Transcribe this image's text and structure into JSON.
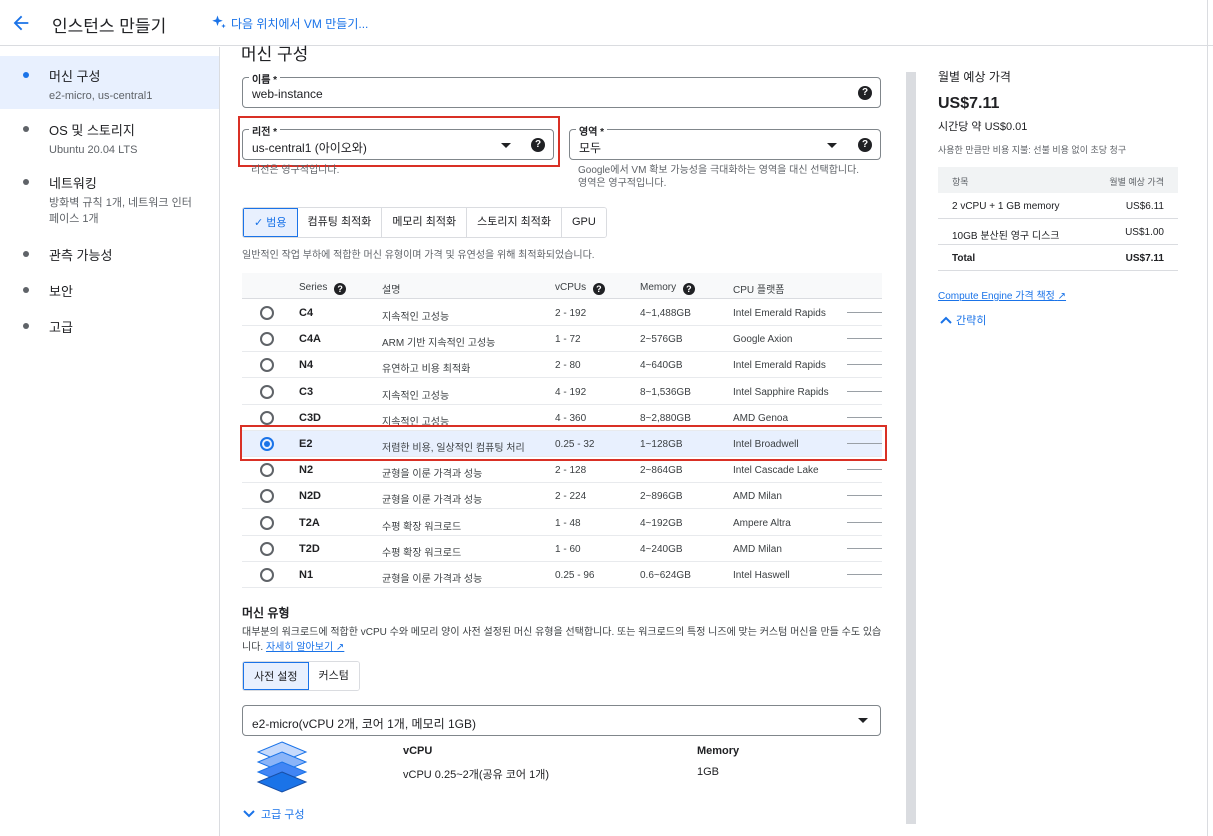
{
  "header": {
    "title": "인스턴스 만들기",
    "vm_link": "다음 위치에서 VM 만들기..."
  },
  "sidebar": {
    "items": [
      {
        "label": "머신 구성",
        "sub": "e2-micro, us-central1"
      },
      {
        "label": "OS 및 스토리지",
        "sub": "Ubuntu 20.04 LTS"
      },
      {
        "label": "네트워킹",
        "sub": "방화벽 규칙 1개, 네트워크 인터페이스 1개"
      },
      {
        "label": "관측 가능성",
        "sub": ""
      },
      {
        "label": "보안",
        "sub": ""
      },
      {
        "label": "고급",
        "sub": ""
      }
    ]
  },
  "main": {
    "section_title": "머신 구성",
    "name_field": {
      "label": "이름 *",
      "value": "web-instance"
    },
    "region_field": {
      "label": "리전 *",
      "value": "us-central1 (아이오와)",
      "hint": "리전은 영구적입니다."
    },
    "zone_field": {
      "label": "영역 *",
      "value": "모두",
      "hint": "Google에서 VM 확보 가능성을 극대화하는 영역을 대신 선택합니다. 영역은 영구적입니다."
    },
    "family_tabs": [
      "범용",
      "컴퓨팅 최적화",
      "메모리 최적화",
      "스토리지 최적화",
      "GPU"
    ],
    "family_desc": "일반적인 작업 부하에 적합한 머신 유형이며 가격 및 유연성을 위해 최적화되었습니다.",
    "table": {
      "headers": [
        "Series",
        "설명",
        "vCPUs",
        "Memory",
        "CPU 플랫폼"
      ],
      "rows": [
        {
          "series": "C4",
          "desc": "지속적인 고성능",
          "vcpus": "2 - 192",
          "memory": "4~1,488GB",
          "platform": "Intel Emerald Rapids",
          "selected": false
        },
        {
          "series": "C4A",
          "desc": "ARM 기반 지속적인 고성능",
          "vcpus": "1 - 72",
          "memory": "2~576GB",
          "platform": "Google Axion",
          "selected": false
        },
        {
          "series": "N4",
          "desc": "유연하고 비용 최적화",
          "vcpus": "2 - 80",
          "memory": "4~640GB",
          "platform": "Intel Emerald Rapids",
          "selected": false
        },
        {
          "series": "C3",
          "desc": "지속적인 고성능",
          "vcpus": "4 - 192",
          "memory": "8~1,536GB",
          "platform": "Intel Sapphire Rapids",
          "selected": false
        },
        {
          "series": "C3D",
          "desc": "지속적인 고성능",
          "vcpus": "4 - 360",
          "memory": "8~2,880GB",
          "platform": "AMD Genoa",
          "selected": false
        },
        {
          "series": "E2",
          "desc": "저렴한 비용, 일상적인 컴퓨팅 처리",
          "vcpus": "0.25 - 32",
          "memory": "1~128GB",
          "platform": "Intel Broadwell",
          "selected": true
        },
        {
          "series": "N2",
          "desc": "균형을 이룬 가격과 성능",
          "vcpus": "2 - 128",
          "memory": "2~864GB",
          "platform": "Intel Cascade Lake",
          "selected": false
        },
        {
          "series": "N2D",
          "desc": "균형을 이룬 가격과 성능",
          "vcpus": "2 - 224",
          "memory": "2~896GB",
          "platform": "AMD Milan",
          "selected": false
        },
        {
          "series": "T2A",
          "desc": "수평 확장 워크로드",
          "vcpus": "1 - 48",
          "memory": "4~192GB",
          "platform": "Ampere Altra",
          "selected": false
        },
        {
          "series": "T2D",
          "desc": "수평 확장 워크로드",
          "vcpus": "1 - 60",
          "memory": "4~240GB",
          "platform": "AMD Milan",
          "selected": false
        },
        {
          "series": "N1",
          "desc": "균형을 이룬 가격과 성능",
          "vcpus": "0.25 - 96",
          "memory": "0.6~624GB",
          "platform": "Intel Haswell",
          "selected": false
        }
      ]
    },
    "machine_type": {
      "title": "머신 유형",
      "desc": "대부분의 워크로드에 적합한 vCPU 수와 메모리 양이 사전 설정된 머신 유형을 선택합니다. 또는 워크로드의 특정 니즈에 맞는 커스텀 머신을 만들 수도 있습니다.",
      "learn_more": "자세히 알아보기",
      "tabs": [
        "사전 설정",
        "커스텀"
      ],
      "selected_type": "e2-micro(vCPU 2개, 코어 1개, 메모리 1GB)",
      "vcpu_head": "vCPU",
      "vcpu_val": "vCPU 0.25~2개(공유 코어 1개)",
      "mem_head": "Memory",
      "mem_val": "1GB",
      "advanced": "고급 구성"
    }
  },
  "pricing": {
    "title": "월별 예상 가격",
    "price": "US$7.11",
    "hourly": "시간당 약 US$0.01",
    "note": "사용한 만큼만 비용 지불: 선불 비용 없이 초당 청구",
    "table_head": [
      "항목",
      "월별 예상 가격"
    ],
    "rows": [
      {
        "item": "2 vCPU + 1 GB memory",
        "price": "US$6.11"
      },
      {
        "item": "10GB 분산된 영구 디스크",
        "price": "US$1.00"
      },
      {
        "item": "Total",
        "price": "US$7.11"
      }
    ],
    "link": "Compute Engine 가격 책정",
    "collapse": "간략히"
  }
}
